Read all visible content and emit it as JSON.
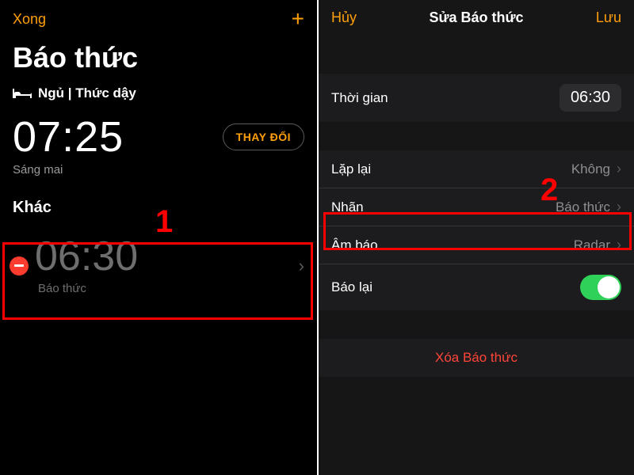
{
  "left": {
    "nav_done": "Xong",
    "title": "Báo thức",
    "sleep_label": "Ngủ | Thức dậy",
    "wake_time": "07:25",
    "change": "THAY ĐỔI",
    "tomorrow": "Sáng mai",
    "other": "Khác",
    "alarm": {
      "time": "06:30",
      "label": "Báo thức"
    },
    "callout": "1"
  },
  "right": {
    "nav_cancel": "Hủy",
    "nav_title": "Sửa Báo thức",
    "nav_save": "Lưu",
    "time_key": "Thời gian",
    "time_val": "06:30",
    "repeat_key": "Lặp lại",
    "repeat_val": "Không",
    "label_key": "Nhãn",
    "label_val": "Báo thức",
    "sound_key": "Âm báo",
    "sound_val": "Radar",
    "snooze_key": "Báo lại",
    "delete": "Xóa Báo thức",
    "callout": "2"
  }
}
